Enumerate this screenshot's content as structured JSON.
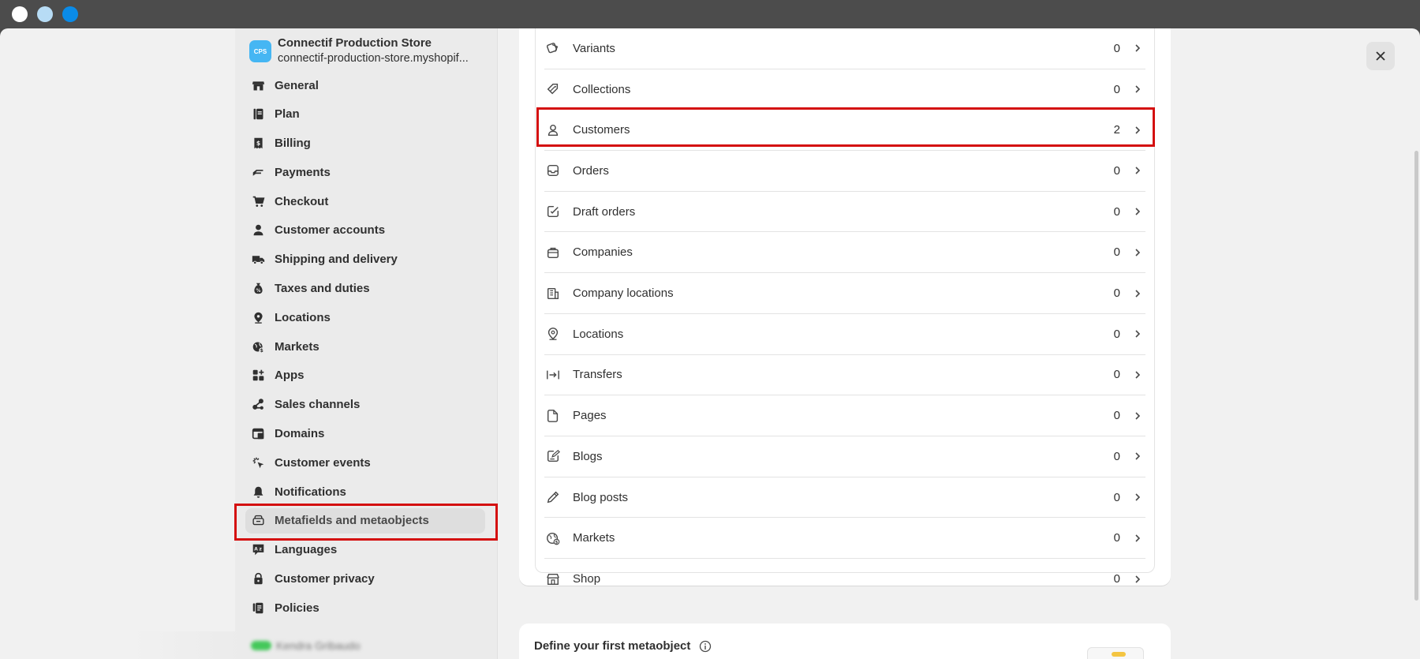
{
  "window": {
    "close_label": "Close"
  },
  "store": {
    "logo_text": "CPS",
    "name": "Connectif Production Store",
    "domain": "connectif-production-store.myshopif..."
  },
  "sidebar": {
    "items": [
      {
        "label": "General",
        "icon": "store-icon"
      },
      {
        "label": "Plan",
        "icon": "plan-icon"
      },
      {
        "label": "Billing",
        "icon": "billing-icon"
      },
      {
        "label": "Payments",
        "icon": "payments-icon"
      },
      {
        "label": "Checkout",
        "icon": "cart-icon"
      },
      {
        "label": "Customer accounts",
        "icon": "person-icon"
      },
      {
        "label": "Shipping and delivery",
        "icon": "truck-icon"
      },
      {
        "label": "Taxes and duties",
        "icon": "tax-icon"
      },
      {
        "label": "Locations",
        "icon": "location-pin-icon"
      },
      {
        "label": "Markets",
        "icon": "globe-icon"
      },
      {
        "label": "Apps",
        "icon": "apps-icon"
      },
      {
        "label": "Sales channels",
        "icon": "sales-channels-icon"
      },
      {
        "label": "Domains",
        "icon": "domains-icon"
      },
      {
        "label": "Customer events",
        "icon": "cursor-click-icon"
      },
      {
        "label": "Notifications",
        "icon": "bell-icon"
      },
      {
        "label": "Metafields and metaobjects",
        "icon": "metafields-icon",
        "active": true
      },
      {
        "label": "Languages",
        "icon": "languages-icon"
      },
      {
        "label": "Customer privacy",
        "icon": "lock-icon"
      },
      {
        "label": "Policies",
        "icon": "policies-icon"
      }
    ],
    "user_name": "Kendra Gribaudo"
  },
  "metafield_list": {
    "rows": [
      {
        "label": "Variants",
        "count": "0",
        "icon": "variants-icon"
      },
      {
        "label": "Collections",
        "count": "0",
        "icon": "collections-icon"
      },
      {
        "label": "Customers",
        "count": "2",
        "icon": "person-outline-icon",
        "highlighted": true
      },
      {
        "label": "Orders",
        "count": "0",
        "icon": "orders-icon"
      },
      {
        "label": "Draft orders",
        "count": "0",
        "icon": "draft-orders-icon"
      },
      {
        "label": "Companies",
        "count": "0",
        "icon": "companies-icon"
      },
      {
        "label": "Company locations",
        "count": "0",
        "icon": "company-locations-icon"
      },
      {
        "label": "Locations",
        "count": "0",
        "icon": "location-outline-icon"
      },
      {
        "label": "Transfers",
        "count": "0",
        "icon": "transfers-icon"
      },
      {
        "label": "Pages",
        "count": "0",
        "icon": "page-icon"
      },
      {
        "label": "Blogs",
        "count": "0",
        "icon": "blog-icon"
      },
      {
        "label": "Blog posts",
        "count": "0",
        "icon": "pencil-icon"
      },
      {
        "label": "Markets",
        "count": "0",
        "icon": "globe-outline-icon"
      },
      {
        "label": "Shop",
        "count": "0",
        "icon": "shop-icon"
      }
    ]
  },
  "metaobject_card": {
    "title": "Define your first metaobject"
  },
  "colors": {
    "highlight": "#d40f0f",
    "store_logo": "#45b6f3",
    "active_nav_bg": "#dedede"
  }
}
